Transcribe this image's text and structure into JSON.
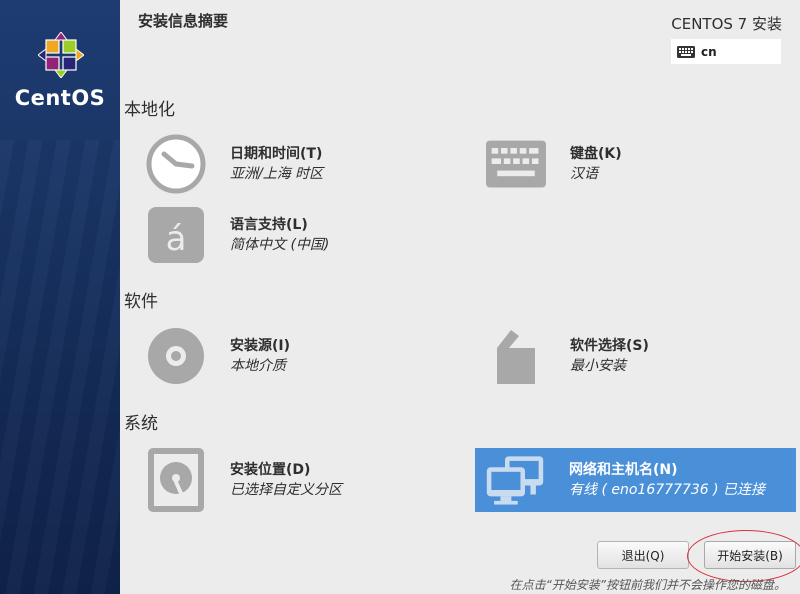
{
  "sidebar": {
    "brand": "CentOS"
  },
  "header": {
    "title": "安装信息摘要",
    "product": "CENTOS 7 安装",
    "keyboard_layout": "cn"
  },
  "sections": {
    "localization": "本地化",
    "software": "软件",
    "system": "系统"
  },
  "spokes": {
    "datetime": {
      "label": "日期和时间(T)",
      "status": "亚洲/上海 时区",
      "icon": "clock-icon"
    },
    "keyboard": {
      "label": "键盘(K)",
      "status": "汉语",
      "icon": "keyboard-icon"
    },
    "language": {
      "label": "语言支持(L)",
      "status": "简体中文 (中国)",
      "icon": "language-icon"
    },
    "source": {
      "label": "安装源(I)",
      "status": "本地介质",
      "icon": "disc-icon"
    },
    "software": {
      "label": "软件选择(S)",
      "status": "最小安装",
      "icon": "package-icon"
    },
    "destination": {
      "label": "安装位置(D)",
      "status": "已选择自定义分区",
      "icon": "harddisk-icon"
    },
    "network": {
      "label": "网络和主机名(N)",
      "status": "有线 ( eno16777736 ) 已连接",
      "icon": "network-icon"
    }
  },
  "buttons": {
    "quit": "退出(Q)",
    "begin": "开始安装(B)"
  },
  "footer": {
    "note": "在点击“开始安装”按钮前我们并不会操作您的磁盘。"
  },
  "colors": {
    "selected": "#4a90d9",
    "sidebar": "#1a3566",
    "highlight": "#d8343c"
  }
}
